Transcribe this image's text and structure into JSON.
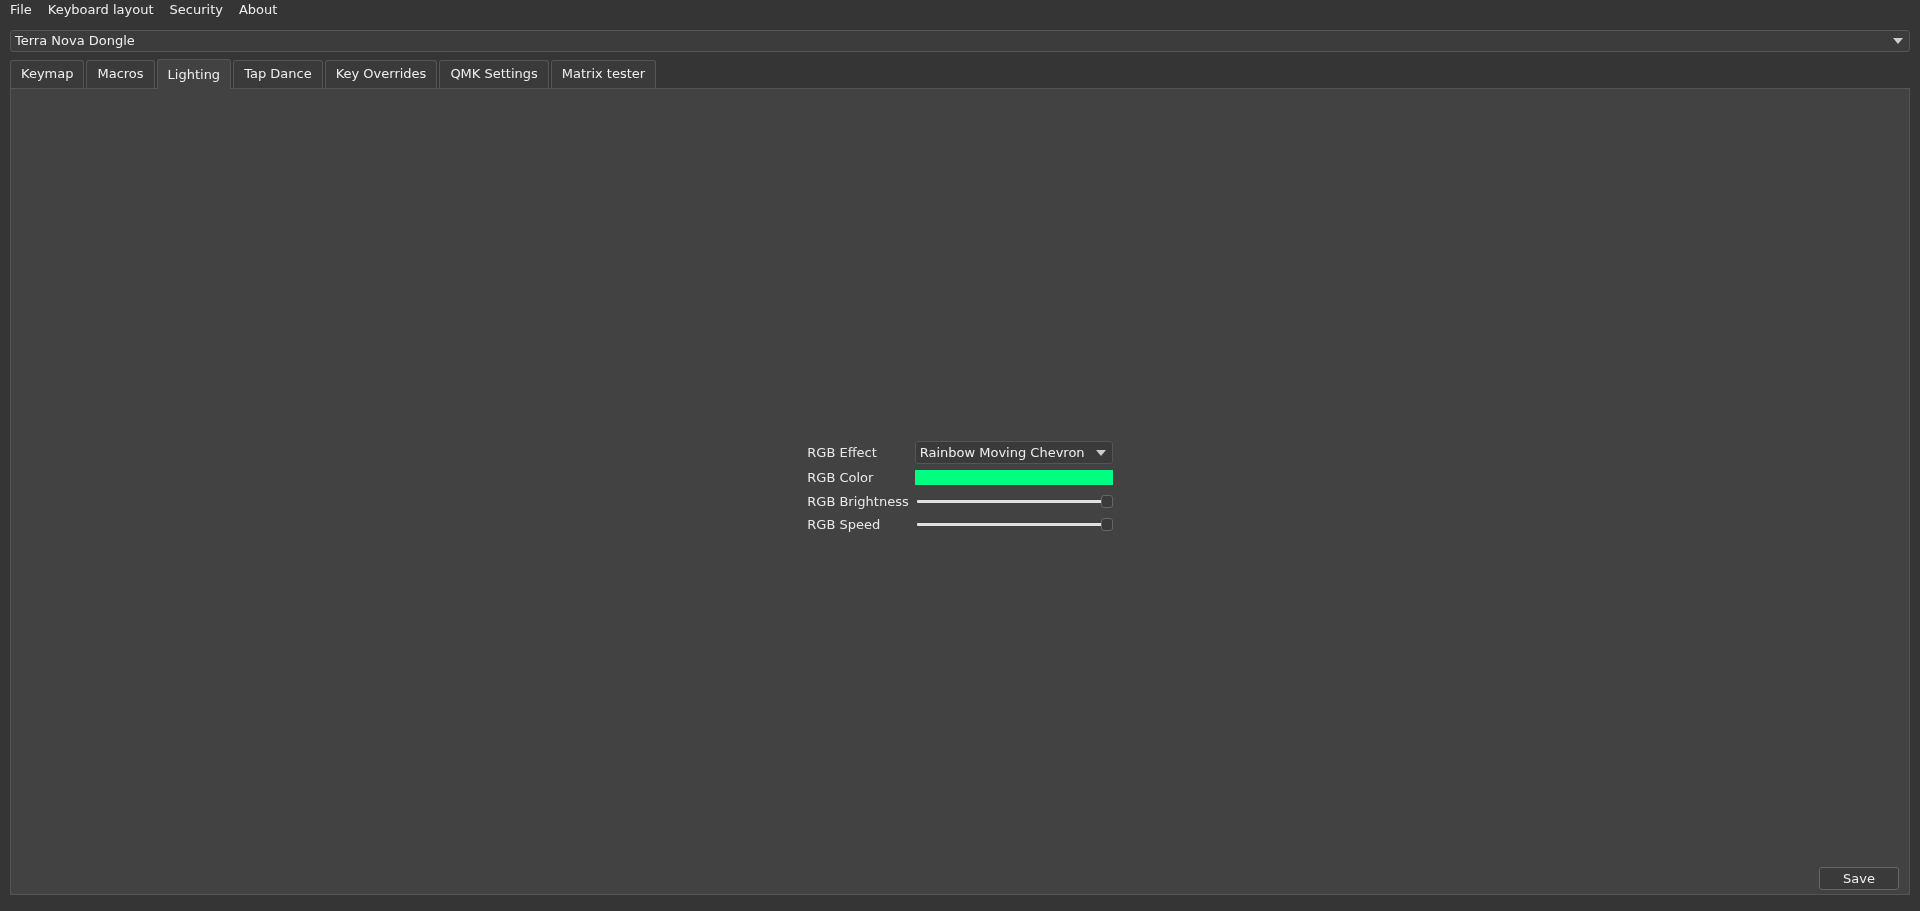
{
  "menu": [
    "File",
    "Keyboard layout",
    "Security",
    "About"
  ],
  "device_select": {
    "value": "Terra Nova Dongle"
  },
  "tabs": [
    {
      "label": "Keymap",
      "selected": false
    },
    {
      "label": "Macros",
      "selected": false
    },
    {
      "label": "Lighting",
      "selected": true
    },
    {
      "label": "Tap Dance",
      "selected": false
    },
    {
      "label": "Key Overrides",
      "selected": false
    },
    {
      "label": "QMK Settings",
      "selected": false
    },
    {
      "label": "Matrix tester",
      "selected": false
    }
  ],
  "lighting": [
    {
      "kind": "dropdown",
      "label": "RGB Effect",
      "value": "Rainbow Moving Chevron"
    },
    {
      "kind": "color",
      "label": "RGB Color",
      "color": "#00ff80"
    },
    {
      "kind": "slider",
      "label": "RGB Brightness",
      "level": 1.0
    },
    {
      "kind": "slider",
      "label": "RGB Speed",
      "level": 1.0
    }
  ],
  "save_button": "Save"
}
